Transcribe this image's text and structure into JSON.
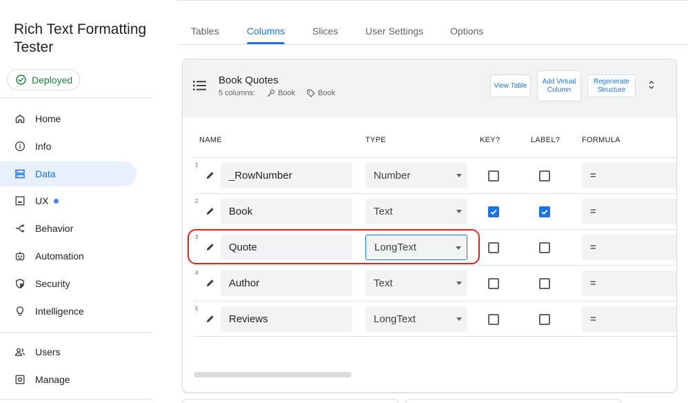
{
  "app": {
    "title": "Rich Text Formatting Tester",
    "status": "Deployed",
    "status_color": "#188038"
  },
  "sidebar": {
    "items": [
      {
        "label": "Home",
        "icon": "home-icon"
      },
      {
        "label": "Info",
        "icon": "info-icon"
      },
      {
        "label": "Data",
        "icon": "data-icon",
        "active": true
      },
      {
        "label": "UX",
        "icon": "ux-icon",
        "has_dot": true
      },
      {
        "label": "Behavior",
        "icon": "behavior-icon"
      },
      {
        "label": "Automation",
        "icon": "automation-icon"
      },
      {
        "label": "Security",
        "icon": "security-icon"
      },
      {
        "label": "Intelligence",
        "icon": "lightbulb-icon"
      },
      {
        "label": "Users",
        "icon": "users-icon"
      },
      {
        "label": "Manage",
        "icon": "manage-icon"
      }
    ]
  },
  "tabs": [
    {
      "label": "Tables"
    },
    {
      "label": "Columns",
      "active": true
    },
    {
      "label": "Slices"
    },
    {
      "label": "User Settings"
    },
    {
      "label": "Options"
    }
  ],
  "table": {
    "name": "Book Quotes",
    "columns_count": "5 columns:",
    "key": "Book",
    "label": "Book",
    "buttons": {
      "view_table": "View Table",
      "add_virtual_column": "Add Virtual Column",
      "regenerate_structure": "Regenerate Structure"
    }
  },
  "column_headers": {
    "name": "NAME",
    "type": "TYPE",
    "key": "KEY?",
    "label": "LABEL?",
    "formula": "FORMULA"
  },
  "rows": [
    {
      "num": "1",
      "name": "_RowNumber",
      "type": "Number",
      "key": false,
      "label": false,
      "formula": "="
    },
    {
      "num": "2",
      "name": "Book",
      "type": "Text",
      "key": true,
      "label": true,
      "formula": "="
    },
    {
      "num": "3",
      "name": "Quote",
      "type": "LongText",
      "key": false,
      "label": false,
      "formula": "=",
      "highlighted": true
    },
    {
      "num": "4",
      "name": "Author",
      "type": "Text",
      "key": false,
      "label": false,
      "formula": "="
    },
    {
      "num": "5",
      "name": "Reviews",
      "type": "LongText",
      "key": false,
      "label": false,
      "formula": "="
    }
  ],
  "colors": {
    "accent": "#1a73e8",
    "highlight": "#e5231b",
    "field_bg": "#f1f3f4"
  }
}
